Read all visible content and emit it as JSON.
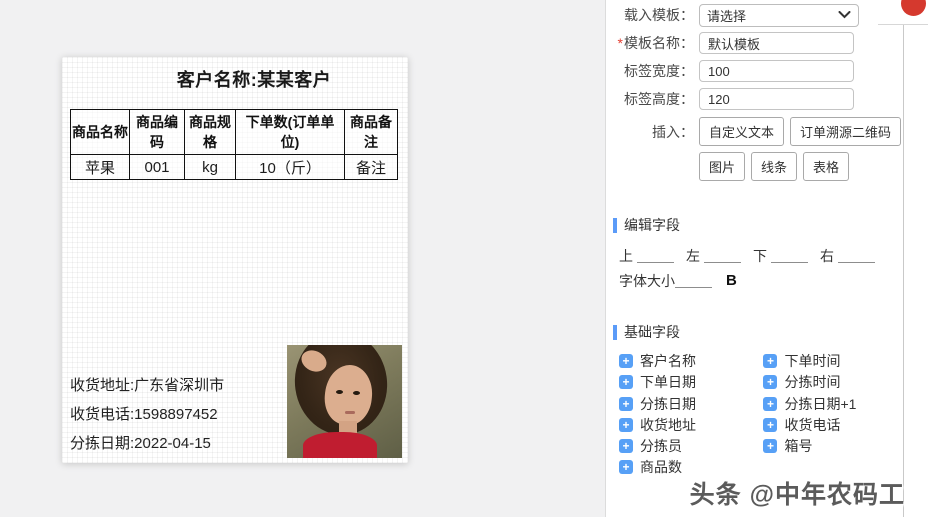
{
  "canvas": {
    "label": {
      "title": "客户名称:某某客户",
      "table": {
        "headers": [
          "商品名称",
          "商品编码",
          "商品规格",
          "下单数(订单单位)",
          "商品备注"
        ],
        "rows": [
          [
            "苹果",
            "001",
            "kg",
            "10（斤）",
            "备注"
          ]
        ]
      },
      "footer_lines": {
        "address": "收货地址:广东省深圳市",
        "phone": "收货电话:1598897452",
        "sort_date": "分拣日期:2022-04-15"
      },
      "photo": "woman-portrait-photo"
    }
  },
  "panel": {
    "form": {
      "load_template_label": "载入模板：",
      "load_template_value": "请选择",
      "required_mark": "*",
      "template_name_label": "模板名称：",
      "template_name_value": "默认模板",
      "label_width_label": "标签宽度：",
      "label_width_value": "100",
      "label_height_label": "标签高度：",
      "label_height_value": "120",
      "insert_label": "插入：",
      "insert_buttons_row1": [
        "自定义文本",
        "订单溯源二维码"
      ],
      "insert_buttons_row2": [
        "图片",
        "线条",
        "表格"
      ]
    },
    "edit_section": {
      "title": "编辑字段",
      "margin_labels": [
        "上",
        "左",
        "下",
        "右"
      ],
      "font_size_label": "字体大小",
      "bold_label": "B"
    },
    "basic_section": {
      "title": "基础字段",
      "fields_left": [
        "客户名称",
        "下单日期",
        "分拣日期",
        "收货地址",
        "分拣员",
        "商品数"
      ],
      "fields_right": [
        "下单时间",
        "分拣时间",
        "分拣日期+1",
        "收货电话",
        "箱号"
      ]
    }
  },
  "watermark": "头条 @中年农码工",
  "colors": {
    "accent_blue": "#5b9bf8",
    "plus_icon_blue": "#57a0f6",
    "record_red": "#d5392e",
    "required_red": "#e43d30",
    "canvas_gray": "#f1f1f2"
  }
}
